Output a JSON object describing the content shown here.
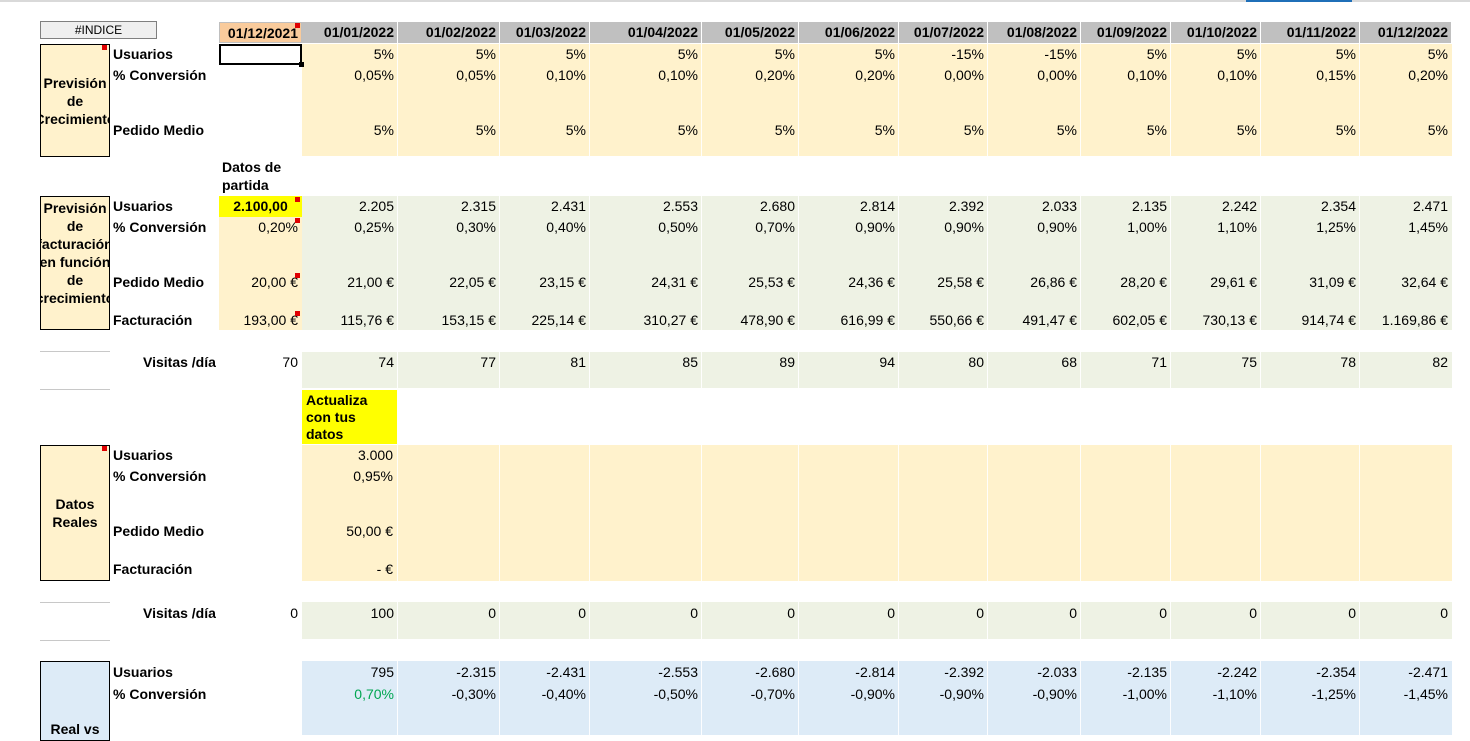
{
  "indice_button": "#INDICE",
  "header_dates": [
    "01/12/2021",
    "01/01/2022",
    "01/02/2022",
    "01/03/2022",
    "01/04/2022",
    "01/05/2022",
    "01/06/2022",
    "01/07/2022",
    "01/08/2022",
    "01/09/2022",
    "01/10/2022",
    "01/11/2022",
    "01/12/2022"
  ],
  "labels": {
    "usuarios": "Usuarios",
    "conversion": "% Conversión",
    "pedido_medio": "Pedido Medio",
    "facturacion": "Facturación",
    "visitas": "Visitas /día",
    "datos_partida": "Datos de partida",
    "actualiza": "Actualiza con tus datos"
  },
  "section_titles": {
    "prevision_crecimiento": "Previsión de Crecimiento",
    "prevision_facturacion": "Previsión de facturación en función de crecimiento",
    "datos_reales": "Datos Reales",
    "real_vs": "Real vs Previsión"
  },
  "growth": {
    "usuarios": [
      "5%",
      "5%",
      "5%",
      "5%",
      "5%",
      "5%",
      "-15%",
      "-15%",
      "5%",
      "5%",
      "5%",
      "5%"
    ],
    "conversion": [
      "0,05%",
      "0,05%",
      "0,10%",
      "0,10%",
      "0,20%",
      "0,20%",
      "0,00%",
      "0,00%",
      "0,10%",
      "0,10%",
      "0,15%",
      "0,20%"
    ],
    "pedido": [
      "5%",
      "5%",
      "5%",
      "5%",
      "5%",
      "5%",
      "5%",
      "5%",
      "5%",
      "5%",
      "5%",
      "5%"
    ]
  },
  "forecast": {
    "usuarios": [
      "2.100,00",
      "2.205",
      "2.315",
      "2.431",
      "2.553",
      "2.680",
      "2.814",
      "2.392",
      "2.033",
      "2.135",
      "2.242",
      "2.354",
      "2.471"
    ],
    "conversion": [
      "0,20%",
      "0,25%",
      "0,30%",
      "0,40%",
      "0,50%",
      "0,70%",
      "0,90%",
      "0,90%",
      "0,90%",
      "1,00%",
      "1,10%",
      "1,25%",
      "1,45%"
    ],
    "pedido": [
      "20,00 €",
      "21,00 €",
      "22,05 €",
      "23,15 €",
      "24,31 €",
      "25,53 €",
      "24,36 €",
      "25,58 €",
      "26,86 €",
      "28,20 €",
      "29,61 €",
      "31,09 €",
      "32,64 €"
    ],
    "facturacion": [
      "193,00 €",
      "115,76 €",
      "153,15 €",
      "225,14 €",
      "310,27 €",
      "478,90 €",
      "616,99 €",
      "550,66 €",
      "491,47 €",
      "602,05 €",
      "730,13 €",
      "914,74 €",
      "1.169,86 €"
    ],
    "visitas": [
      "70",
      "74",
      "77",
      "81",
      "85",
      "89",
      "94",
      "80",
      "68",
      "71",
      "75",
      "78",
      "82"
    ]
  },
  "real": {
    "usuarios": "3.000",
    "conversion": "0,95%",
    "pedido": "50,00 €",
    "facturacion": "- €",
    "visitas": [
      "0",
      "100",
      "0",
      "0",
      "0",
      "0",
      "0",
      "0",
      "0",
      "0",
      "0",
      "0",
      "0"
    ]
  },
  "diff": {
    "usuarios": [
      "795",
      "-2.315",
      "-2.431",
      "-2.553",
      "-2.680",
      "-2.814",
      "-2.392",
      "-2.033",
      "-2.135",
      "-2.242",
      "-2.354",
      "-2.471"
    ],
    "conversion": [
      "0,70%",
      "-0,30%",
      "-0,40%",
      "-0,50%",
      "-0,70%",
      "-0,90%",
      "-0,90%",
      "-0,90%",
      "-1,00%",
      "-1,10%",
      "-1,25%",
      "-1,45%"
    ]
  },
  "colors": {
    "header_gray": "#c0c0c0",
    "header_first": "#f9cb9c",
    "yellow_fill": "#fff2cc",
    "green_fill": "#eef2e4",
    "blue_fill": "#ddebf7",
    "highlight": "#ffff00",
    "positive_green": "#00a651",
    "comment_red": "#e00000"
  }
}
